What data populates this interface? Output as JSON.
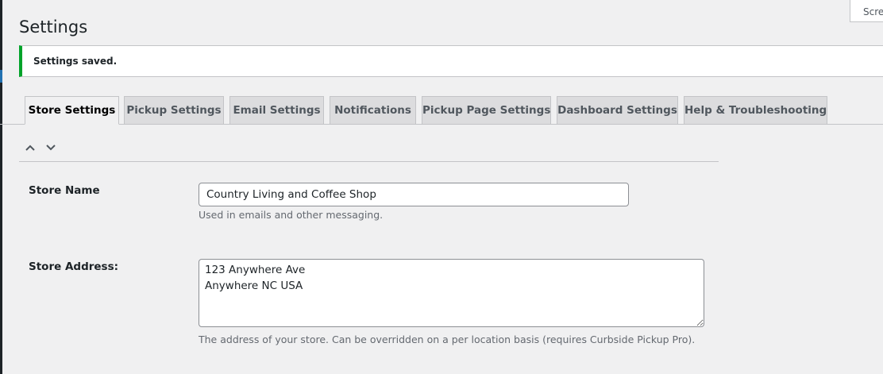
{
  "header": {
    "title": "Settings",
    "screen_options_label": "Screen Options"
  },
  "notice": {
    "text": "Settings saved.",
    "color": "#00a32a"
  },
  "tabs": [
    {
      "label": "Store Settings",
      "active": true
    },
    {
      "label": "Pickup Settings",
      "active": false
    },
    {
      "label": "Email Settings",
      "active": false
    },
    {
      "label": "Notifications",
      "active": false
    },
    {
      "label": "Pickup Page Settings",
      "active": false
    },
    {
      "label": "Dashboard Settings",
      "active": false
    },
    {
      "label": "Help & Troubleshooting",
      "active": false
    }
  ],
  "section_controls": {
    "move_up_icon": "chevron-up-icon",
    "move_down_icon": "chevron-down-icon"
  },
  "fields": {
    "store_name": {
      "label": "Store Name",
      "value": "Country Living and Coffee Shop",
      "description": "Used in emails and other messaging."
    },
    "store_address": {
      "label": "Store Address:",
      "value": "123 Anywhere Ave\nAnywhere NC USA",
      "description": "The address of your store. Can be overridden on a per location basis (requires Curbside Pickup Pro)."
    }
  }
}
